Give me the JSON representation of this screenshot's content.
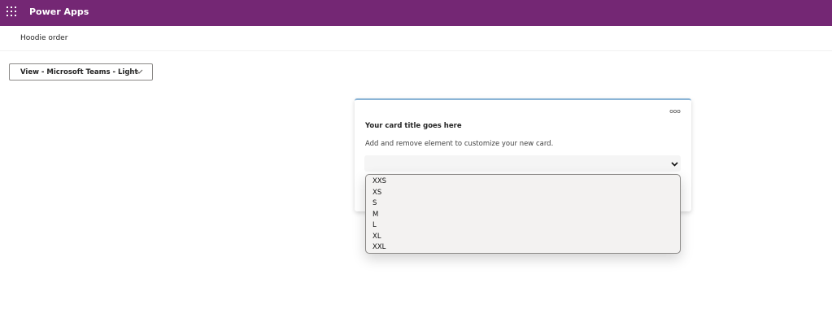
{
  "topbar": {
    "app_title": "Power Apps",
    "waffle_icon": "waffle-grid-icon",
    "background": "#742774"
  },
  "subheader": {
    "title": "Hoodie order"
  },
  "view_selector": {
    "label": "View - Microsoft Teams - Light",
    "icon": "chevron-down-icon"
  },
  "card": {
    "more_icon": "more-horizontal-icon",
    "title": "Your card title goes here",
    "description": "Add and remove element to customize your new card.",
    "select": {
      "value": "",
      "icon": "chevron-down-icon"
    }
  },
  "dropdown": {
    "options": [
      "XXS",
      "XS",
      "S",
      "M",
      "L",
      "XL",
      "XXL"
    ]
  }
}
